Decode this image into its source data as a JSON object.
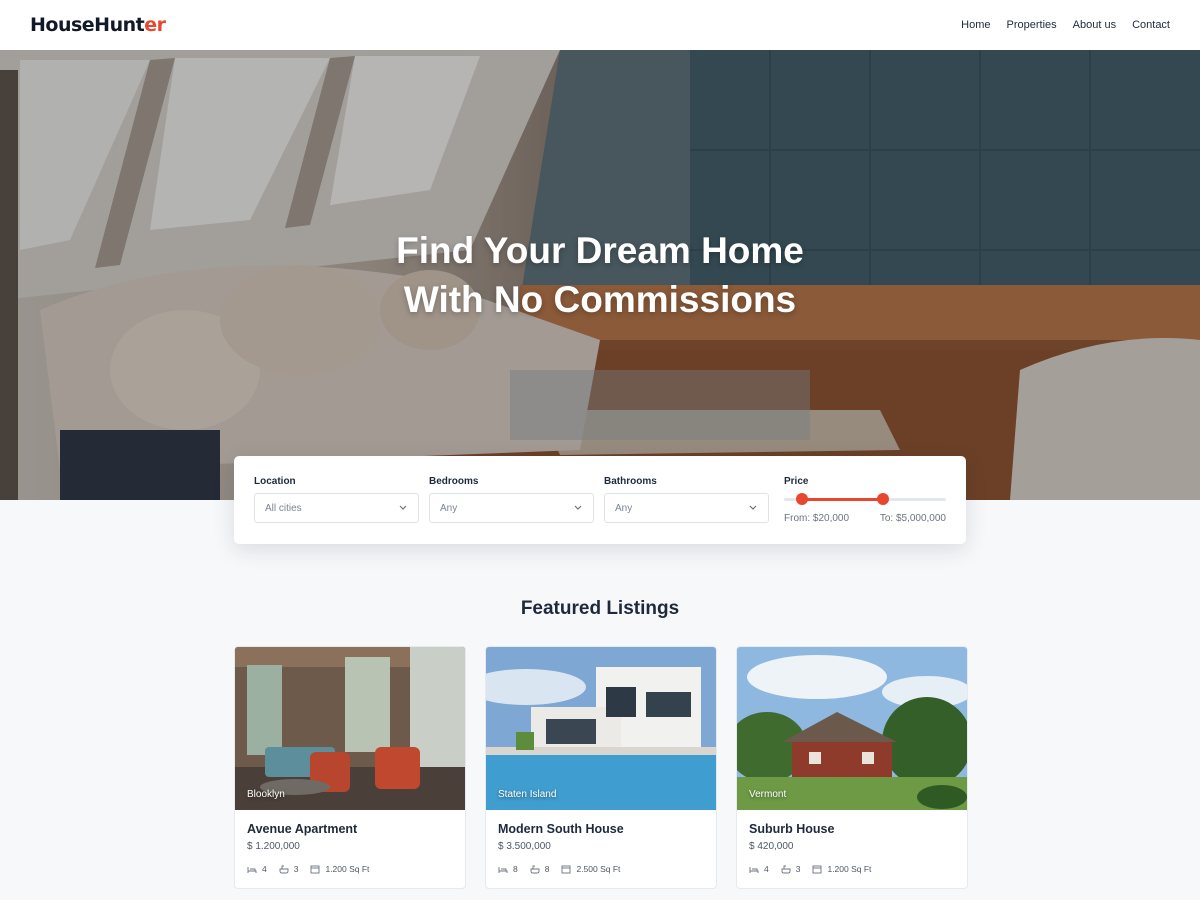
{
  "brand": {
    "name_part1": "HouseHun",
    "name_part2": "t",
    "name_part3": "er",
    "accent_color": "#e8472f"
  },
  "nav": {
    "items": [
      "Home",
      "Properties",
      "About us",
      "Contact"
    ]
  },
  "hero": {
    "title_line1": "Find Your Dream Home",
    "title_line2": "With No Commissions"
  },
  "search": {
    "location": {
      "label": "Location",
      "value": "All cities"
    },
    "bedrooms": {
      "label": "Bedrooms",
      "value": "Any"
    },
    "bathrooms": {
      "label": "Bathrooms",
      "value": "Any"
    },
    "price": {
      "label": "Price",
      "from": "From: $20,000",
      "to": "To: $5,000,000",
      "range_start_fraction": 0.11,
      "range_end_fraction": 0.6
    }
  },
  "featured": {
    "title": "Featured Listings",
    "listings": [
      {
        "city": "Blooklyn",
        "title": "Avenue Apartment",
        "price": "$ 1.200,000",
        "beds": "4",
        "baths": "3",
        "area": "1.200 Sq Ft"
      },
      {
        "city": "Staten Island",
        "title": "Modern South House",
        "price": "$ 3.500,000",
        "beds": "8",
        "baths": "8",
        "area": "2.500 Sq Ft"
      },
      {
        "city": "Vermont",
        "title": "Suburb House",
        "price": "$ 420,000",
        "beds": "4",
        "baths": "3",
        "area": "1.200 Sq Ft"
      }
    ]
  },
  "icons": {
    "chevron": "chevron-down-icon",
    "bed": "bed-icon",
    "bath": "bath-icon",
    "area": "area-icon"
  }
}
